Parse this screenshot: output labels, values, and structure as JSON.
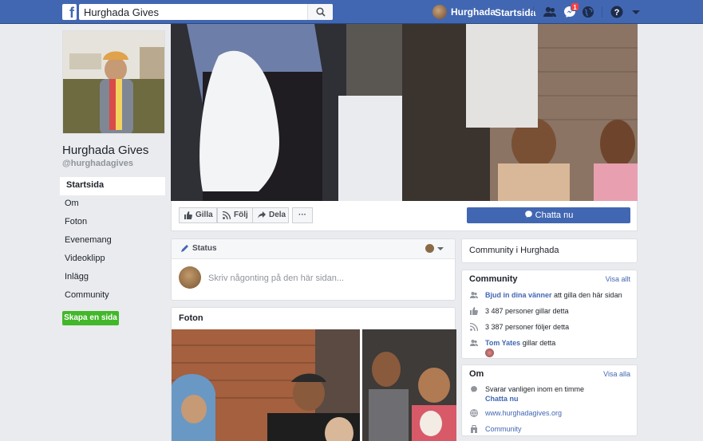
{
  "colors": {
    "brand": "#4267b2",
    "create_button": "#42b72a",
    "link": "#4267b2",
    "badge": "#fa3e3e"
  },
  "topbar": {
    "search_value": "Hurghada Gives",
    "user_name": "Hurghada",
    "home_label": "Startsida",
    "messages_badge": "1",
    "icons": [
      "facebook-logo-icon",
      "search-icon",
      "friend-requests-icon",
      "messenger-icon",
      "notifications-globe-icon",
      "help-icon",
      "account-menu-caret-icon"
    ]
  },
  "page": {
    "name": "Hurghada Gives",
    "handle": "@hurghadagives"
  },
  "left_nav": {
    "items": [
      "Startsida",
      "Om",
      "Foton",
      "Evenemang",
      "Videoklipp",
      "Inlägg",
      "Community"
    ],
    "create_button": "Skapa en sida"
  },
  "actions": {
    "like": "Gilla",
    "follow": "Följ",
    "share": "Dela",
    "more": "···",
    "chat": "Chatta nu"
  },
  "status": {
    "tab": "Status",
    "placeholder": "Skriv någonting på den här sidan..."
  },
  "photos": {
    "title": "Foton"
  },
  "right": {
    "community_city": "Community i Hurghada",
    "community": {
      "title": "Community",
      "see_all": "Visa allt",
      "invite_link": "Bjud in dina vänner",
      "invite_rest": " att gilla den här sidan",
      "likes": "3 487 personer gillar detta",
      "follows": "3 387 personer följer detta",
      "friend_name": "Tom Yates",
      "friend_rest": " gillar detta"
    },
    "about": {
      "title": "Om",
      "see_all": "Visa alla",
      "response": "Svarar vanligen inom en timme",
      "chat_link": "Chatta nu",
      "website": "www.hurghadagives.org",
      "category": "Community"
    }
  }
}
